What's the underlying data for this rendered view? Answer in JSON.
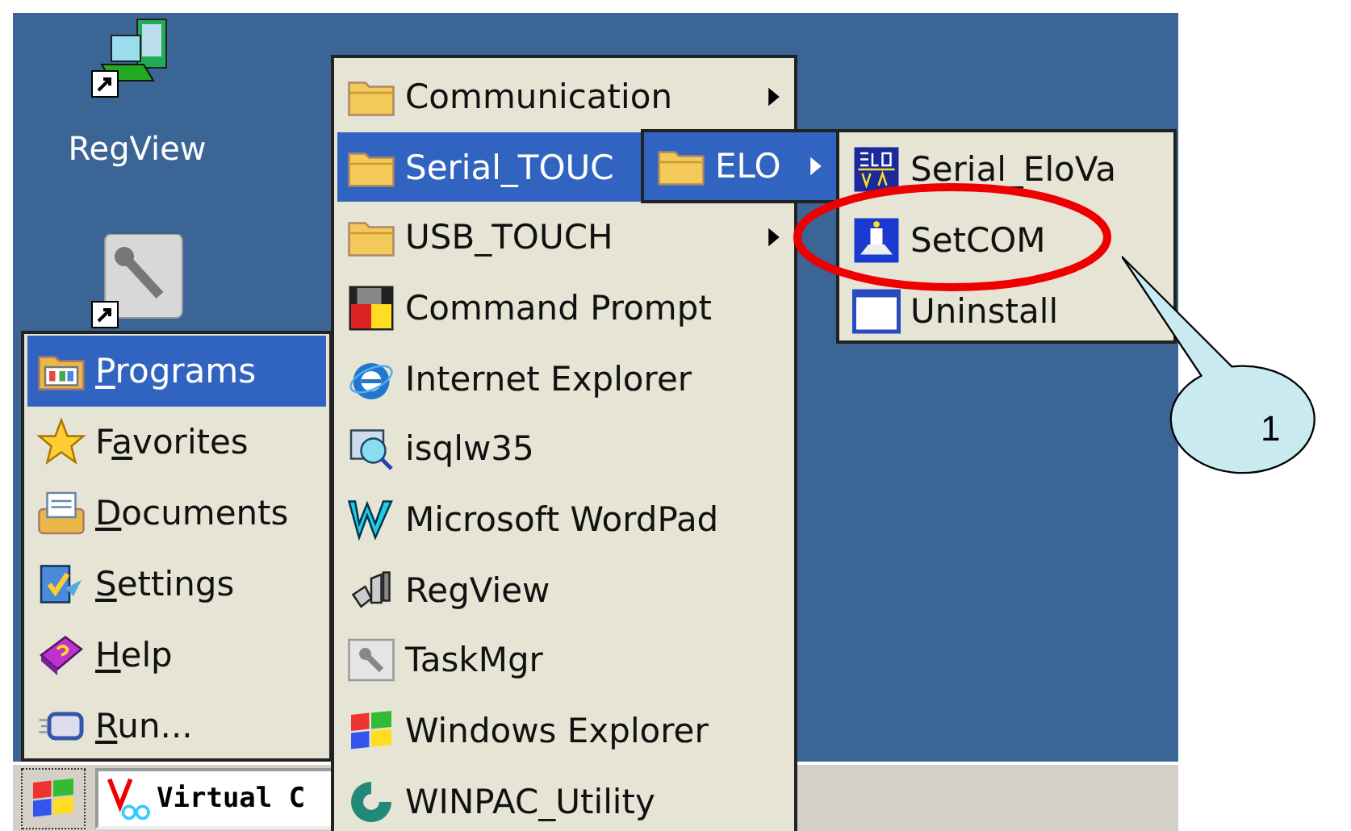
{
  "desktop_icons": [
    {
      "kind": "network",
      "label": "RegView"
    },
    {
      "kind": "tool"
    }
  ],
  "start_menu": {
    "items": [
      {
        "kind": "programs",
        "mnemonic": "P",
        "text_after": "rograms",
        "selected": true
      },
      {
        "kind": "favorites",
        "text_before": "F",
        "mnemonic": "a",
        "text_after": "vorites",
        "selected": false
      },
      {
        "kind": "documents",
        "mnemonic": "D",
        "text_after": "ocuments",
        "selected": false
      },
      {
        "kind": "settings",
        "mnemonic": "S",
        "text_after": "ettings",
        "selected": false
      },
      {
        "kind": "help",
        "mnemonic": "H",
        "text_after": "elp",
        "selected": false
      },
      {
        "kind": "run",
        "mnemonic": "R",
        "text_after": "un...",
        "selected": false
      }
    ]
  },
  "programs_menu": {
    "items": [
      {
        "kind": "folder",
        "label": "Communication",
        "submenu": true,
        "selected": false
      },
      {
        "kind": "folder",
        "label": "Serial_TOUC",
        "submenu": false,
        "selected": true
      },
      {
        "kind": "folder",
        "label": "USB_TOUCH",
        "submenu": true,
        "selected": false
      },
      {
        "kind": "cmd",
        "label": "Command Prompt",
        "submenu": false,
        "selected": false
      },
      {
        "kind": "ie",
        "label": "Internet Explorer",
        "submenu": false,
        "selected": false
      },
      {
        "kind": "sql",
        "label": "isqlw35",
        "submenu": false,
        "selected": false
      },
      {
        "kind": "wordpad",
        "label": "Microsoft WordPad",
        "submenu": false,
        "selected": false
      },
      {
        "kind": "regview",
        "label": "RegView",
        "submenu": false,
        "selected": false
      },
      {
        "kind": "taskmgr",
        "label": "TaskMgr",
        "submenu": false,
        "selected": false
      },
      {
        "kind": "explorer",
        "label": "Windows Explorer",
        "submenu": false,
        "selected": false
      },
      {
        "kind": "winpac",
        "label": "WINPAC_Utility",
        "submenu": false,
        "selected": false
      }
    ]
  },
  "serial_touch_menu": {
    "items": [
      {
        "kind": "folder",
        "label": "ELO",
        "submenu": true,
        "selected": true
      }
    ]
  },
  "elo_menu": {
    "items": [
      {
        "kind": "elova",
        "label": "Serial_EloVa",
        "circled": false
      },
      {
        "kind": "setcom",
        "label": "SetCOM",
        "circled": true
      },
      {
        "kind": "blank",
        "label": "Uninstall",
        "circled": false
      }
    ]
  },
  "taskbar": {
    "buttons": [
      {
        "label": "Virtual C"
      }
    ]
  },
  "callout": {
    "label": "1"
  }
}
